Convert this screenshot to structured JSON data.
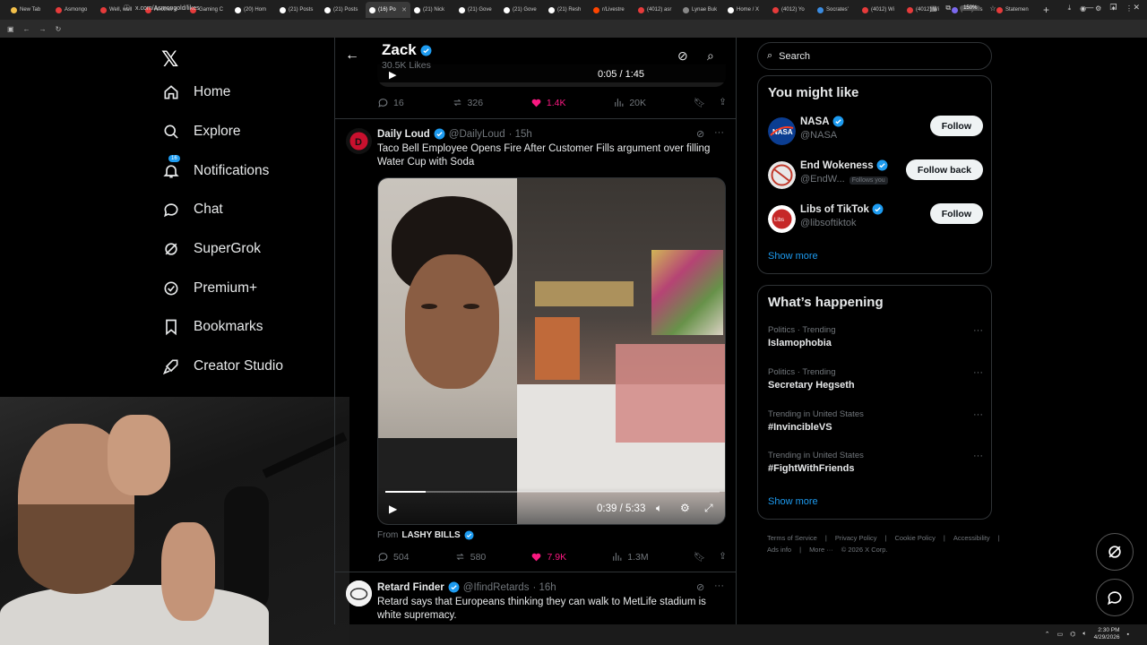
{
  "browser": {
    "tabs": [
      {
        "label": "New Tab",
        "color": "#f3c04a"
      },
      {
        "label": "Asmongo",
        "color": "#e63b3b"
      },
      {
        "label": "Well, well",
        "color": "#e63b3b"
      },
      {
        "label": "Another c",
        "color": "#e63b3b"
      },
      {
        "label": "Gaming C",
        "color": "#e63b3b"
      },
      {
        "label": "(20) Hom",
        "color": "#ffffff"
      },
      {
        "label": "(21) Posts",
        "color": "#ffffff"
      },
      {
        "label": "(21) Posts",
        "color": "#ffffff"
      },
      {
        "label": "(16) Po",
        "color": "#ffffff",
        "active": true
      },
      {
        "label": "(21) Nick",
        "color": "#ffffff"
      },
      {
        "label": "(21) Gove",
        "color": "#ffffff"
      },
      {
        "label": "(21) Gove",
        "color": "#ffffff"
      },
      {
        "label": "(21) Resh",
        "color": "#ffffff"
      },
      {
        "label": "r/Livestre",
        "color": "#ff4500"
      },
      {
        "label": "(4012) asr",
        "color": "#e63b3b"
      },
      {
        "label": "Lynae Buk",
        "color": "#888888"
      },
      {
        "label": "Home / X",
        "color": "#ffffff"
      },
      {
        "label": "(4012) Yo",
        "color": "#e63b3b"
      },
      {
        "label": "Socrates'",
        "color": "#3a8be0"
      },
      {
        "label": "(4012) Wi",
        "color": "#e63b3b"
      },
      {
        "label": "(4012) Wi",
        "color": "#e63b3b"
      },
      {
        "label": "(99+) Dis",
        "color": "#7b68ee"
      },
      {
        "label": "Statemen",
        "color": "#e63b3b"
      }
    ],
    "url": "x.com/Asmongold/likes",
    "zoom": "150%"
  },
  "nav": {
    "items": [
      {
        "label": "Home",
        "icon": "home-icon"
      },
      {
        "label": "Explore",
        "icon": "search-icon"
      },
      {
        "label": "Notifications",
        "icon": "bell-icon",
        "badge": "16"
      },
      {
        "label": "Chat",
        "icon": "chat-icon"
      },
      {
        "label": "SuperGrok",
        "icon": "grok-icon"
      },
      {
        "label": "Premium+",
        "icon": "premium-icon"
      },
      {
        "label": "Bookmarks",
        "icon": "bookmark-icon"
      },
      {
        "label": "Creator Studio",
        "icon": "rocket-icon"
      }
    ]
  },
  "profile": {
    "name": "Zack",
    "likes": "30.5K Likes"
  },
  "prev_tweet": {
    "video_time": "0:05 / 1:45",
    "replies": "16",
    "reposts": "326",
    "likes": "1.4K",
    "views": "20K"
  },
  "tweet": {
    "name": "Daily Loud",
    "handle": "@DailyLoud",
    "time": "· 15h",
    "text": "Taco Bell Employee Opens Fire After Customer Fills argument over filling Water Cup with Soda",
    "video_time": "0:39 / 5:33",
    "video_progress": 0.12,
    "from_label": "From",
    "from_source": "LASHY BILLS",
    "replies": "504",
    "reposts": "580",
    "likes": "7.9K",
    "views": "1.3M"
  },
  "next_tweet": {
    "name": "Retard Finder",
    "handle": "@IfindRetards",
    "time": "· 16h",
    "text": "Retard says that Europeans thinking they can walk to MetLife stadium is white supremacy."
  },
  "search": {
    "placeholder": "Search"
  },
  "suggestions": {
    "title": "You might like",
    "items": [
      {
        "name": "NASA",
        "handle": "@NASA",
        "button": "Follow"
      },
      {
        "name": "End Wokeness",
        "handle": "@EndW...",
        "follows_you": "Follows you",
        "button": "Follow back"
      },
      {
        "name": "Libs of TikTok",
        "handle": "@libsoftiktok",
        "button": "Follow"
      }
    ],
    "show_more": "Show more"
  },
  "trending": {
    "title": "What’s happening",
    "items": [
      {
        "category": "Politics · Trending",
        "name": "Islamophobia"
      },
      {
        "category": "Politics · Trending",
        "name": "Secretary Hegseth"
      },
      {
        "category": "Trending in United States",
        "name": "#InvincibleVS"
      },
      {
        "category": "Trending in United States",
        "name": "#FightWithFriends"
      }
    ],
    "show_more": "Show more"
  },
  "footer": [
    "Terms of Service",
    "|",
    "Privacy Policy",
    "|",
    "Cookie Policy",
    "|",
    "Accessibility",
    "|",
    "Ads info",
    "|",
    "More ···",
    "© 2026 X Corp."
  ],
  "taskbar": {
    "time": "2:30 PM",
    "date": "4/29/2026"
  },
  "colors": {
    "accent": "#1d9bf0",
    "like": "#f91880",
    "muted": "#71767b"
  }
}
